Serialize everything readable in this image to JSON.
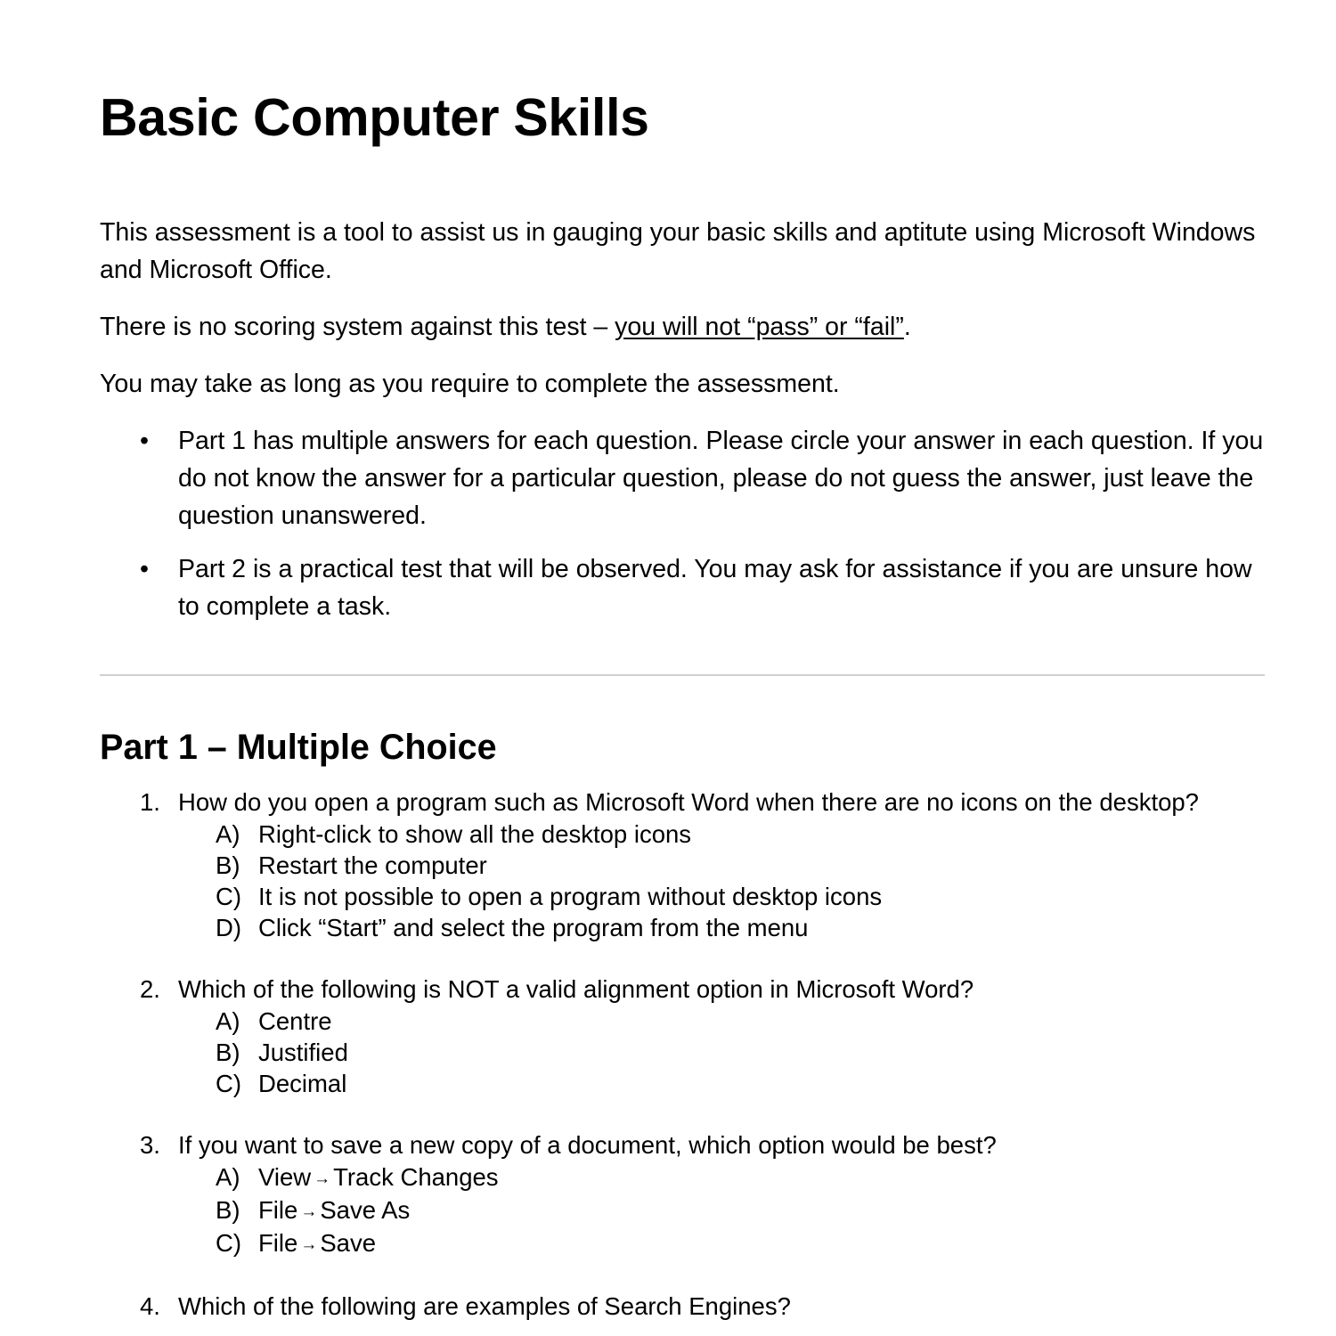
{
  "document": {
    "title": "Basic Computer Skills",
    "intro": {
      "paragraph_1": "This assessment is a tool to assist us in gauging your basic skills and aptitute using Microsoft Windows and Microsoft Office.",
      "paragraph_2_before": "There is no scoring system against this test – ",
      "paragraph_2_underlined": "you will not “pass” or “fail”",
      "paragraph_2_after": ".",
      "paragraph_3": "You may take as long as you require to complete the assessment."
    },
    "bullet_marker": "•",
    "bullets": [
      "Part 1 has multiple answers for each question. Please circle your answer in each question. If you do not know the answer for a particular question, please do not guess the answer, just leave the question unanswered.",
      "Part 2 is a practical test that will be observed. You may ask for assistance if you are unsure how to complete a task."
    ],
    "section": {
      "heading": "Part 1 – Multiple Choice"
    },
    "questions": [
      {
        "number": "1.",
        "text": "How do you open a program such as Microsoft Word when there are no icons on the desktop?",
        "options": [
          {
            "letter": "A)",
            "text": "Right-click to show all the desktop icons"
          },
          {
            "letter": "B)",
            "text": "Restart the computer"
          },
          {
            "letter": "C)",
            "text": "It is not possible to open a program without desktop icons"
          },
          {
            "letter": "D)",
            "text": "Click “Start” and select the program from the menu"
          }
        ]
      },
      {
        "number": "2.",
        "text": "Which of the following is NOT a valid alignment option in Microsoft Word?",
        "options": [
          {
            "letter": "A)",
            "text": "Centre"
          },
          {
            "letter": "B)",
            "text": "Justified"
          },
          {
            "letter": "C)",
            "text": "Decimal"
          }
        ]
      },
      {
        "number": "3.",
        "text": "If you want to save a new copy of a document, which option would be best?",
        "options": [
          {
            "letter": "A)",
            "text_before": "View",
            "arrow": "→",
            "text_after": "Track Changes"
          },
          {
            "letter": "B)",
            "text_before": "File",
            "arrow": "→",
            "text_after": "Save As"
          },
          {
            "letter": "C)",
            "text_before": "File",
            "arrow": "→",
            "text_after": "Save"
          }
        ]
      },
      {
        "number": "4.",
        "text": "Which of the following are examples of Search Engines?",
        "options": []
      }
    ],
    "colors": {
      "text": "#000000",
      "background": "#ffffff",
      "divider": "#cfcfcf"
    }
  }
}
